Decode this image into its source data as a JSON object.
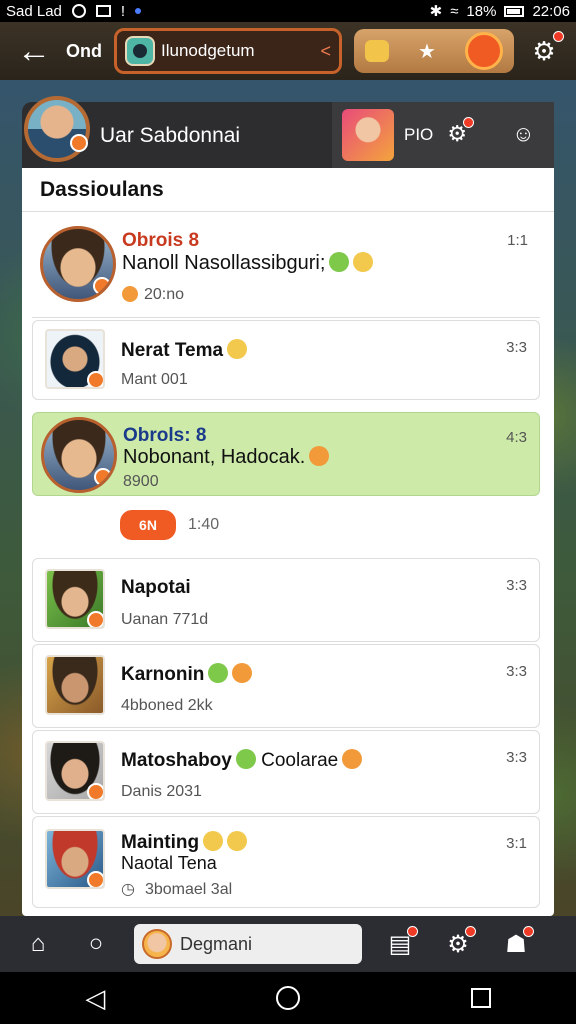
{
  "status_bar": {
    "carrier": "Sad Lad",
    "battery": "18%",
    "time": "22:06"
  },
  "topbar": {
    "back_icon": "back-arrow-icon",
    "label": "Ond",
    "chat_title": "Ilunodgetum",
    "actions": [
      "gift-icon",
      "star-icon",
      "smile-icon"
    ],
    "settings_icon": "settings-icon"
  },
  "profile": {
    "name": "Uar Sabdonnai",
    "tab_label": "PIO"
  },
  "list": {
    "section_title": "Dassioulans",
    "conversations": [
      {
        "name": "Obrois 8",
        "message": "Nanoll Nasollassibguri;",
        "meta": "20:no",
        "time": "1:1"
      },
      {
        "name": "Nerat Tema",
        "message": "",
        "meta": "Mant 001",
        "time": "3:3"
      },
      {
        "name": "Obrols: 8",
        "message": "Nobonant, Hadocak.",
        "meta": "8900",
        "time": "4:3"
      },
      {
        "name": "Napotai",
        "message": "",
        "meta": "Uanan 771d",
        "time": "3:3"
      },
      {
        "name": "Karnonin",
        "message": "",
        "meta": "4bboned 2kk",
        "time": "3:3"
      },
      {
        "name": "Matoshaboy",
        "message": "Coolarae",
        "meta": "Danis 2031",
        "time": "3:3"
      },
      {
        "name": "Mainting",
        "message": "Naotal Tena",
        "meta": "3bomael 3al",
        "time": "3:1"
      }
    ],
    "tag": {
      "label": "6N",
      "meta": "1:40"
    }
  },
  "bottom": {
    "search_label": "Degmani"
  },
  "colors": {
    "accent": "#f05a23",
    "active_row": "#cdeaa9",
    "title_red": "#c83a1f"
  }
}
